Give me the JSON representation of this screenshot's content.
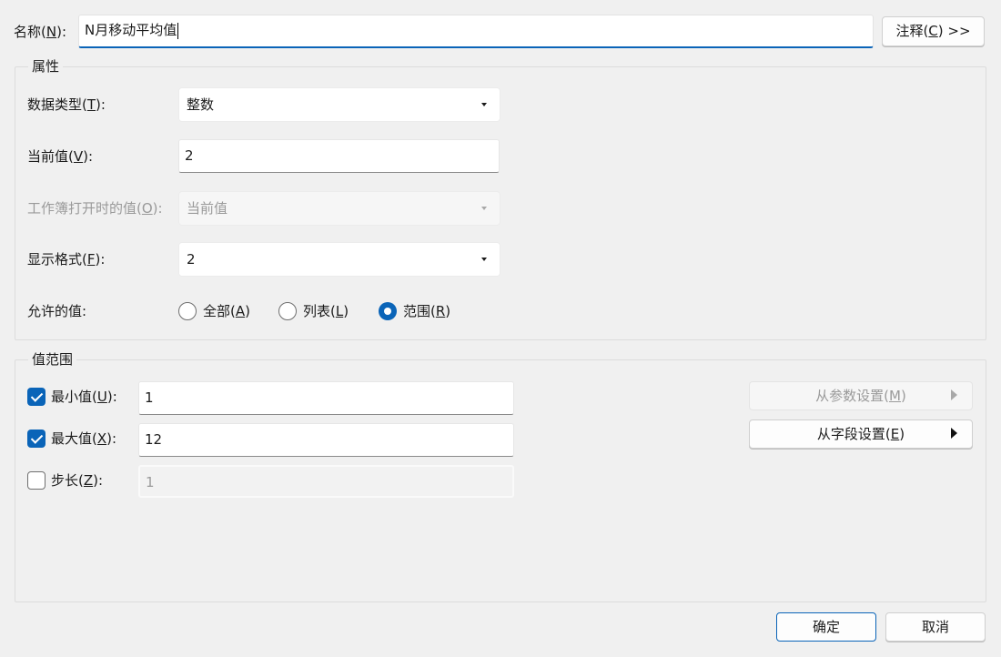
{
  "header": {
    "name_label": {
      "pre": "名称(",
      "key": "N",
      "post": "):"
    },
    "name_value": "N月移动平均值",
    "comment_button": {
      "pre": "注释(",
      "key": "C",
      "post": ") >>"
    }
  },
  "properties": {
    "title": "属性",
    "data_type": {
      "label": {
        "pre": "数据类型(",
        "key": "T",
        "post": "):"
      },
      "value": "整数"
    },
    "current_value": {
      "label": {
        "pre": "当前值(",
        "key": "V",
        "post": "):"
      },
      "value": "2"
    },
    "open_value": {
      "label": {
        "pre": "工作簿打开时的值(",
        "key": "O",
        "post": "):"
      },
      "value": "当前值"
    },
    "display_format": {
      "label": {
        "pre": "显示格式(",
        "key": "F",
        "post": "):"
      },
      "value": "2"
    },
    "allowed": {
      "label": "允许的值:",
      "options": [
        {
          "pre": "全部(",
          "key": "A",
          "post": ")",
          "selected": false
        },
        {
          "pre": "列表(",
          "key": "L",
          "post": ")",
          "selected": false
        },
        {
          "pre": "范围(",
          "key": "R",
          "post": ")",
          "selected": true
        }
      ]
    }
  },
  "range": {
    "title": "值范围",
    "min": {
      "label": {
        "pre": "最小值(",
        "key": "U",
        "post": "):"
      },
      "checked": true,
      "value": "1"
    },
    "max": {
      "label": {
        "pre": "最大值(",
        "key": "X",
        "post": "):"
      },
      "checked": true,
      "value": "12"
    },
    "step": {
      "label": {
        "pre": "步长(",
        "key": "Z",
        "post": "):"
      },
      "checked": false,
      "value": "1"
    },
    "from_param": {
      "pre": "从参数设置(",
      "key": "M",
      "post": ")"
    },
    "from_field": {
      "pre": "从字段设置(",
      "key": "E",
      "post": ")"
    }
  },
  "footer": {
    "ok": "确定",
    "cancel": "取消"
  },
  "colors": {
    "accent": "#0a64b8",
    "background": "#f0f0f0"
  }
}
